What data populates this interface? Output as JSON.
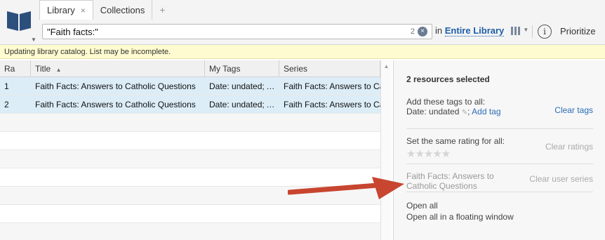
{
  "tabs": {
    "library": "Library",
    "library_close": "×",
    "collections": "Collections",
    "add": "+"
  },
  "search": {
    "value": "\"Faith facts:\"",
    "count": "2",
    "clear_glyph": "×",
    "scope_prefix": "in",
    "scope_link": "Entire Library"
  },
  "toolbar": {
    "info_glyph": "i",
    "prioritize": "Prioritize"
  },
  "notice": "Updating library catalog. List may be incomplete.",
  "table": {
    "columns": [
      "Ra",
      "Title",
      "My Tags",
      "Series"
    ],
    "sort_indicator": "▲",
    "rows": [
      {
        "rating": "1",
        "title": "Faith Facts: Answers to Catholic Questions",
        "tags": "Date: undated; Add tag",
        "series": "Faith Facts: Answers to Catholic Questions"
      },
      {
        "rating": "2",
        "title": "Faith Facts: Answers to Catholic Questions",
        "tags": "Date: undated; Add tag",
        "series": "Faith Facts: Answers to Catholic Questions"
      }
    ]
  },
  "panel": {
    "title": "2 resources selected",
    "tags_label": "Add these tags to all:",
    "tags_value": "Date: undated",
    "add_tag": "Add tag",
    "clear_tags": "Clear tags",
    "rating_label": "Set the same rating for all:",
    "stars": "★★★★★",
    "clear_ratings": "Clear ratings",
    "series_line1": "Faith Facts: Answers to",
    "series_line2": "Catholic Questions",
    "clear_series": "Clear user series",
    "open_all": "Open all",
    "open_floating": "Open all in a floating window"
  },
  "colors": {
    "accent": "#1d5ea8",
    "selection": "#dcedf7",
    "notice": "#fffbd0",
    "arrow": "#c8452f"
  }
}
